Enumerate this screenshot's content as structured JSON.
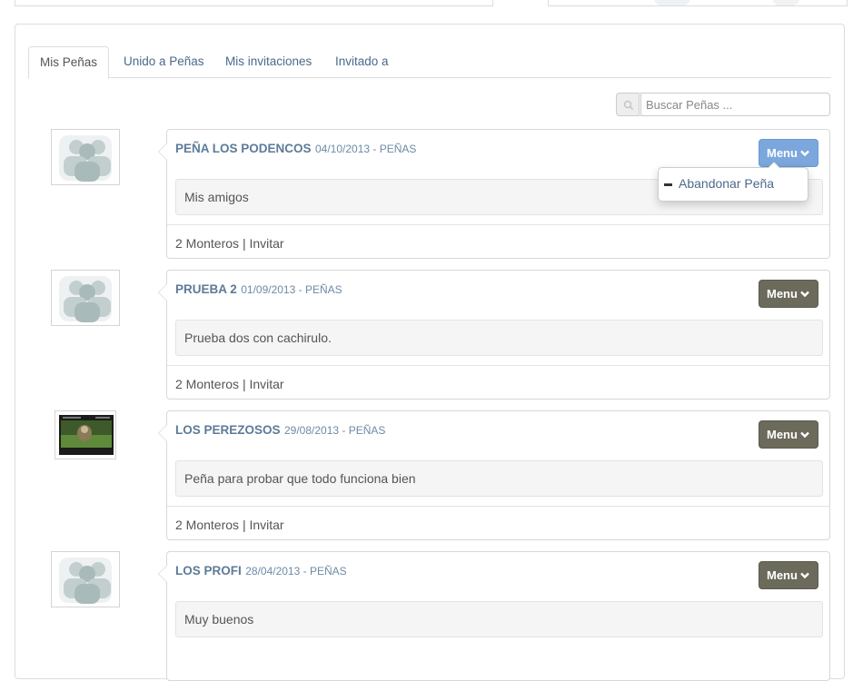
{
  "tabs": [
    {
      "label": "Mis Peñas",
      "active": true
    },
    {
      "label": "Unido a Peñas",
      "active": false
    },
    {
      "label": "Mis invitaciones",
      "active": false
    },
    {
      "label": "Invitado a",
      "active": false
    }
  ],
  "search": {
    "placeholder": "Buscar Peñas ...",
    "value": "",
    "icon": "search-icon"
  },
  "cards": [
    {
      "name": "PEÑA LOS PODENCOS",
      "meta": "04/10/2013 - PEÑAS",
      "description": "Mis amigos",
      "members": "2 Monteros",
      "separator": "|",
      "invite": "Invitar",
      "menu": "Menu",
      "menu_open": true,
      "avatar": "group-icon"
    },
    {
      "name": "PRUEBA 2",
      "meta": "01/09/2013 - PEÑAS",
      "description": "Prueba dos con cachirulo.",
      "members": "2 Monteros",
      "separator": "|",
      "invite": "Invitar",
      "menu": "Menu",
      "menu_open": false,
      "avatar": "group-icon"
    },
    {
      "name": "LOS PEREZOSOS",
      "meta": "29/08/2013 - PEÑAS",
      "description": "Peña para probar que todo funciona bien",
      "members": "2 Monteros",
      "separator": "|",
      "invite": "Invitar",
      "menu": "Menu",
      "menu_open": false,
      "avatar": "sloth-photo"
    },
    {
      "name": "LOS PROFI",
      "meta": "28/04/2013 - PEÑAS",
      "description": "Muy buenos",
      "members": "",
      "separator": "",
      "invite": "",
      "menu": "Menu",
      "menu_open": false,
      "avatar": "group-icon"
    }
  ],
  "dropdown": {
    "item": "Abandonar Peña"
  },
  "colors": {
    "accent": "#7ba7dc",
    "menu_button": "#6b6a5b",
    "link": "#4a6a8c",
    "title": "#5d7a99"
  }
}
